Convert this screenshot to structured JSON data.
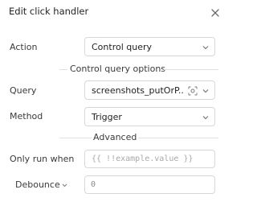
{
  "header": {
    "title": "Edit click handler",
    "close_icon": "close-icon"
  },
  "action": {
    "label": "Action",
    "value": "Control query"
  },
  "control_query_options": {
    "heading": "Control query options"
  },
  "query": {
    "label": "Query",
    "value": "screenshots_putOrP...",
    "icon": "variable-scan-icon"
  },
  "method": {
    "label": "Method",
    "value": "Trigger"
  },
  "advanced": {
    "heading": "Advanced"
  },
  "only_run_when": {
    "label": "Only run when",
    "placeholder": "{{ !!example.value }}"
  },
  "debounce": {
    "label": "Debounce",
    "value": "0"
  },
  "colors": {
    "border": "#d8d8d8",
    "divider": "#e0e0e0",
    "text": "#1f1f1f",
    "placeholder": "#a9a9a9"
  }
}
